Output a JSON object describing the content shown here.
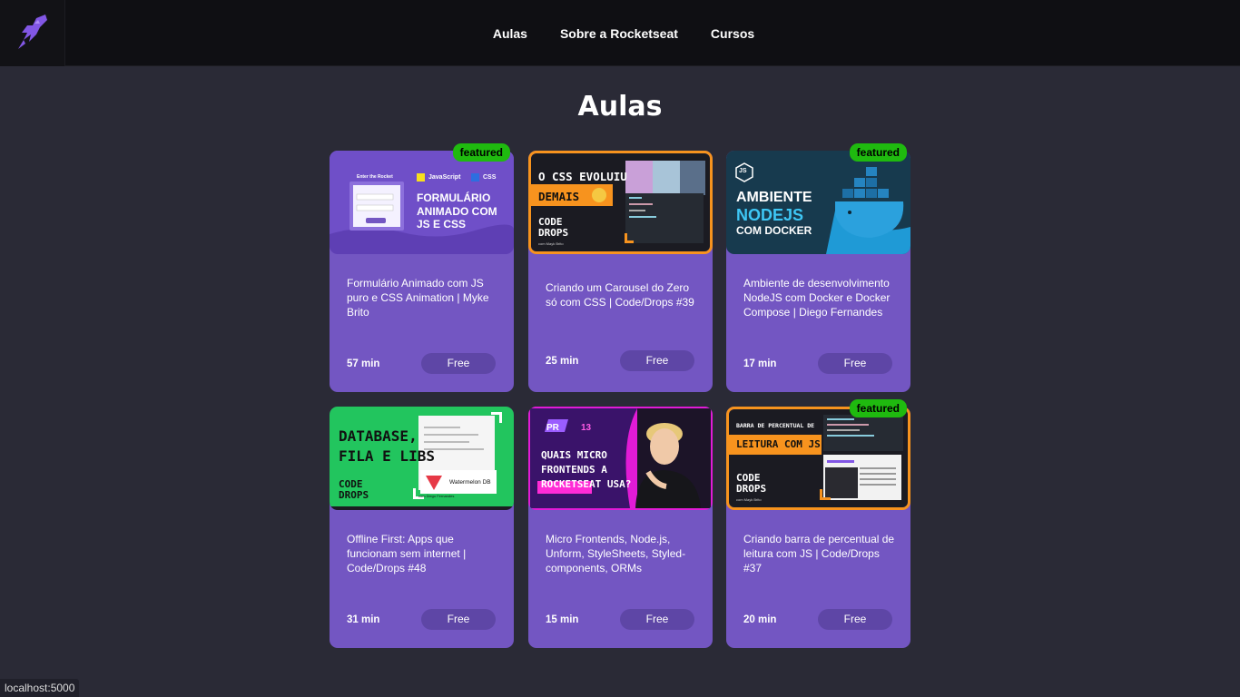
{
  "nav": {
    "links": [
      "Aulas",
      "Sobre a Rocketseat",
      "Cursos"
    ]
  },
  "page": {
    "title": "Aulas"
  },
  "status_bar": "localhost:5000",
  "cards": [
    {
      "title": "Formulário Animado com JS puro e CSS Animation | Myke Brito",
      "duration": "57 min",
      "price": "Free",
      "featured": "featured",
      "thumb": {
        "small": "Enter the Rocket",
        "tags": [
          "JavaScript",
          "CSS"
        ],
        "headline": [
          "FORMULÁRIO",
          "ANIMADO COM",
          "JS E CSS"
        ]
      }
    },
    {
      "title": "Criando um Carousel do Zero só com CSS | Code/Drops #39",
      "duration": "25 min",
      "price": "Free",
      "thumb": {
        "headline": [
          "O CSS EVOLUIU",
          "DEMAIS"
        ],
        "brand": [
          "CODE",
          "DROPS"
        ],
        "byline": "com Mayk Brito"
      }
    },
    {
      "title": "Ambiente de desenvolvimento NodeJS com Docker e Docker Compose | Diego Fernandes",
      "duration": "17 min",
      "price": "Free",
      "featured": "featured",
      "thumb": {
        "headline": [
          "AMBIENTE",
          "NODEJS",
          "COM DOCKER"
        ],
        "logo": "JS"
      }
    },
    {
      "title": "Offline First: Apps que funcionam sem internet | Code/Drops #48",
      "duration": "31 min",
      "price": "Free",
      "thumb": {
        "headline": [
          "DATABASE,",
          "FILA E LIBS"
        ],
        "brand": [
          "CODE",
          "DROPS"
        ],
        "byline": "com Diego Fernandes",
        "product": "Watermelon DB"
      }
    },
    {
      "title": "Micro Frontends, Node.js, Unform, StyleSheets, Styled-components, ORMs",
      "duration": "15 min",
      "price": "Free",
      "thumb": {
        "tag": "PR",
        "num": "13",
        "headline": [
          "QUAIS MICRO",
          "FRONTENDS A",
          "ROCKETSEAT",
          "USA?"
        ]
      }
    },
    {
      "title": "Criando barra de percentual de leitura com JS | Code/Drops #37",
      "duration": "20 min",
      "price": "Free",
      "featured": "featured",
      "thumb": {
        "headline": [
          "BARRA DE PERCENTUAL DE",
          "LEITURA COM JS"
        ],
        "brand": [
          "CODE",
          "DROPS"
        ],
        "byline": "com Mayk Brito"
      }
    }
  ]
}
